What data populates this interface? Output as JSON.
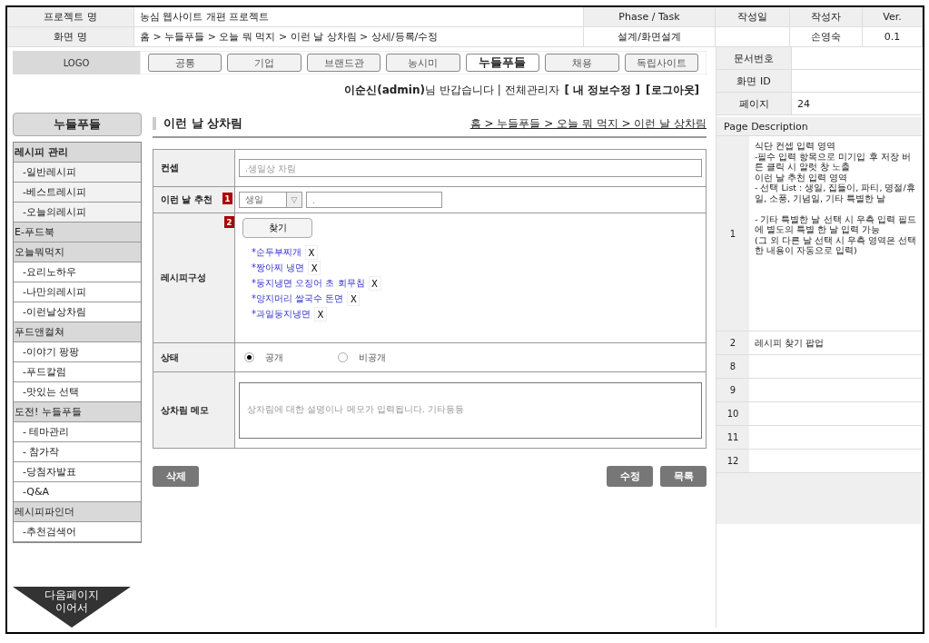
{
  "header": {
    "project_label": "프로젝트 명",
    "project_name": "농심 웹사이트 개편 프로젝트",
    "phase_label": "Phase / Task",
    "phase_value": "설계/화면설계",
    "date_label": "작성일",
    "author_label": "작성자",
    "author": "손영숙",
    "ver_label": "Ver.",
    "ver": "0.1",
    "screen_label": "화면 명",
    "screen_path": "홈 > 누들푸들 > 오늘 뭐 먹지 > 이런 날 상차림 > 상세/등록/수정"
  },
  "meta": [
    {
      "label": "문서번호"
    },
    {
      "label": "화면 ID"
    },
    {
      "label": "페이지",
      "value": "24"
    }
  ],
  "description": {
    "title": "Page Description",
    "rows": [
      {
        "num": "1",
        "text": "식단 컨셉 입력 영역\n-필수 입력 항목으로 미기입 후 저장 버튼 클릭 시 알럿 창 노출\n이런 날 추천 입력 영역\n - 선택 List : 생일, 집들이, 파티, 명절/휴일, 소풍, 기념일, 기타 특별한 날\n\n - 기타 특별한 날 선택 시 우측 입력 필드에 별도의 특별 한 날 입력 가능\n(그 외 다른 날 선택 시 우측 영역은 선택한 내용이 자동으로 입력)"
      },
      {
        "num": "2",
        "text": "레시피 찾기 팝업"
      },
      {
        "num": "8"
      },
      {
        "num": "9"
      },
      {
        "num": "10"
      },
      {
        "num": "11"
      },
      {
        "num": "12"
      }
    ]
  },
  "nav": {
    "logo": "LOGO",
    "tabs": [
      {
        "label": "공통",
        "selected": false
      },
      {
        "label": "기업",
        "selected": false
      },
      {
        "label": "브랜드관",
        "selected": false
      },
      {
        "label": "농시미",
        "selected": false
      },
      {
        "label": "누들푸들",
        "selected": true
      },
      {
        "label": "채용",
        "selected": false
      },
      {
        "label": "독립사이트",
        "selected": false
      }
    ]
  },
  "user": {
    "name": "이순신(admin)",
    "greeting": "님 반갑습니다 | 전체관리자",
    "links": [
      "[ 내 정보수정 ]",
      "[로그아웃]"
    ]
  },
  "sidebar": {
    "title": "누들푸들",
    "groups": [
      {
        "label": "레시피 관리",
        "bold": true,
        "items": [
          {
            "label": "-일반레시피",
            "shaded": true
          },
          {
            "label": "-베스트레시피",
            "shaded": true
          },
          {
            "label": "-오늘의레시피",
            "shaded": true
          }
        ]
      },
      {
        "label": "E-푸드북",
        "bold": false
      },
      {
        "label": "오늘뭐먹지",
        "bold": false,
        "items": [
          {
            "label": "-요리노하우",
            "shaded": false
          },
          {
            "label": "-나만의레시피",
            "shaded": false
          },
          {
            "label": "-이런날상차림",
            "shaded": false
          }
        ]
      },
      {
        "label": "푸드앤컬쳐",
        "bold": false,
        "items": [
          {
            "label": "-이야기 팡팡",
            "shaded": false
          },
          {
            "label": "-푸드칼럼",
            "shaded": false
          },
          {
            "label": "-맛있는 선택",
            "shaded": false
          }
        ]
      },
      {
        "label": "도전! 누들푸들",
        "bold": false,
        "items": [
          {
            "label": "- 테마관리",
            "shaded": false
          },
          {
            "label": "- 참가작",
            "shaded": false
          },
          {
            "label": "-당첨자발표",
            "shaded": false
          },
          {
            "label": "-Q&A",
            "shaded": false
          }
        ]
      },
      {
        "label": "레시피파인더",
        "bold": false,
        "items": [
          {
            "label": "-추천검색어",
            "shaded": false
          }
        ]
      }
    ]
  },
  "content": {
    "title": "이런 날 상차림",
    "breadcrumb": "홈 > 누들푸들 > 오늘 뭐 먹지 > 이런 날 상차림",
    "form": [
      {
        "kind": "text",
        "label": "컨셉",
        "placeholder": ".생일상 차림"
      },
      {
        "kind": "select",
        "label": "이런 날 추천",
        "marker": "1",
        "value": "생일",
        "arrow": "▽",
        "placeholder": "."
      },
      {
        "kind": "recipes",
        "label": "레시피구성",
        "marker": "2",
        "button": "찾기",
        "items": [
          {
            "name": "*순두부찌개",
            "remove": "X"
          },
          {
            "name": "*짱아찌 냉면",
            "remove": "X"
          },
          {
            "name": "*둥지냉면 오징어 초 회무침",
            "remove": "X"
          },
          {
            "name": "*양지머리 쌀국수 돈면",
            "remove": "X"
          },
          {
            "name": "*과일둥지냉면",
            "remove": "X"
          }
        ]
      },
      {
        "kind": "radio",
        "label": "상태",
        "options": [
          {
            "label": "공개",
            "selected": true
          },
          {
            "label": "비공개",
            "selected": false
          }
        ]
      },
      {
        "kind": "textarea",
        "label": "상차림 메모",
        "placeholder": "상차림에 대한 설명이나 메모가 입력됩니다. 기타등등"
      }
    ],
    "left_buttons": [
      "삭제"
    ],
    "right_buttons": [
      "수정",
      "목록"
    ]
  },
  "next_page": "다음페이지\n이어서"
}
